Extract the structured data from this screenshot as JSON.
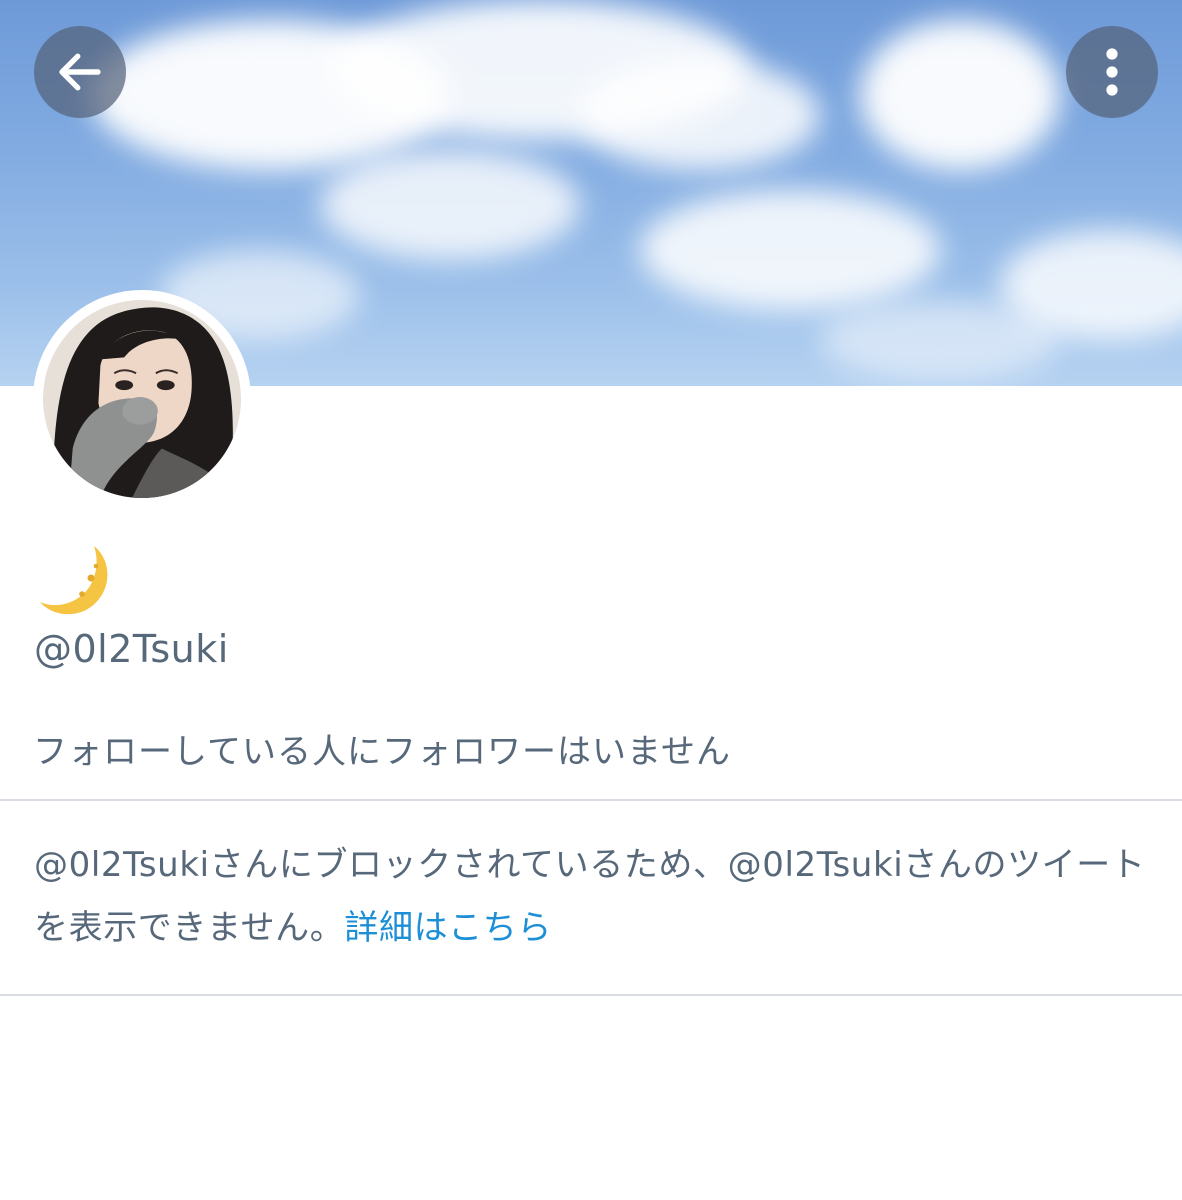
{
  "header": {
    "back_icon": "arrow-left-icon",
    "more_icon": "more-vertical-icon"
  },
  "profile": {
    "display_name_icon": "crescent-moon-icon",
    "handle": "@0l2Tsuki",
    "follow_status": "フォローしている人にフォロワーはいません"
  },
  "block_notice": {
    "text": "@0l2Tsukiさんにブロックされているため、@0l2Tsukiさんのツイートを表示できません。",
    "link_label": "詳細はこちら"
  },
  "colors": {
    "text_secondary": "#56687a",
    "link": "#1d8fd6",
    "divider": "#d7dde3",
    "button_overlay": "#55627a"
  }
}
